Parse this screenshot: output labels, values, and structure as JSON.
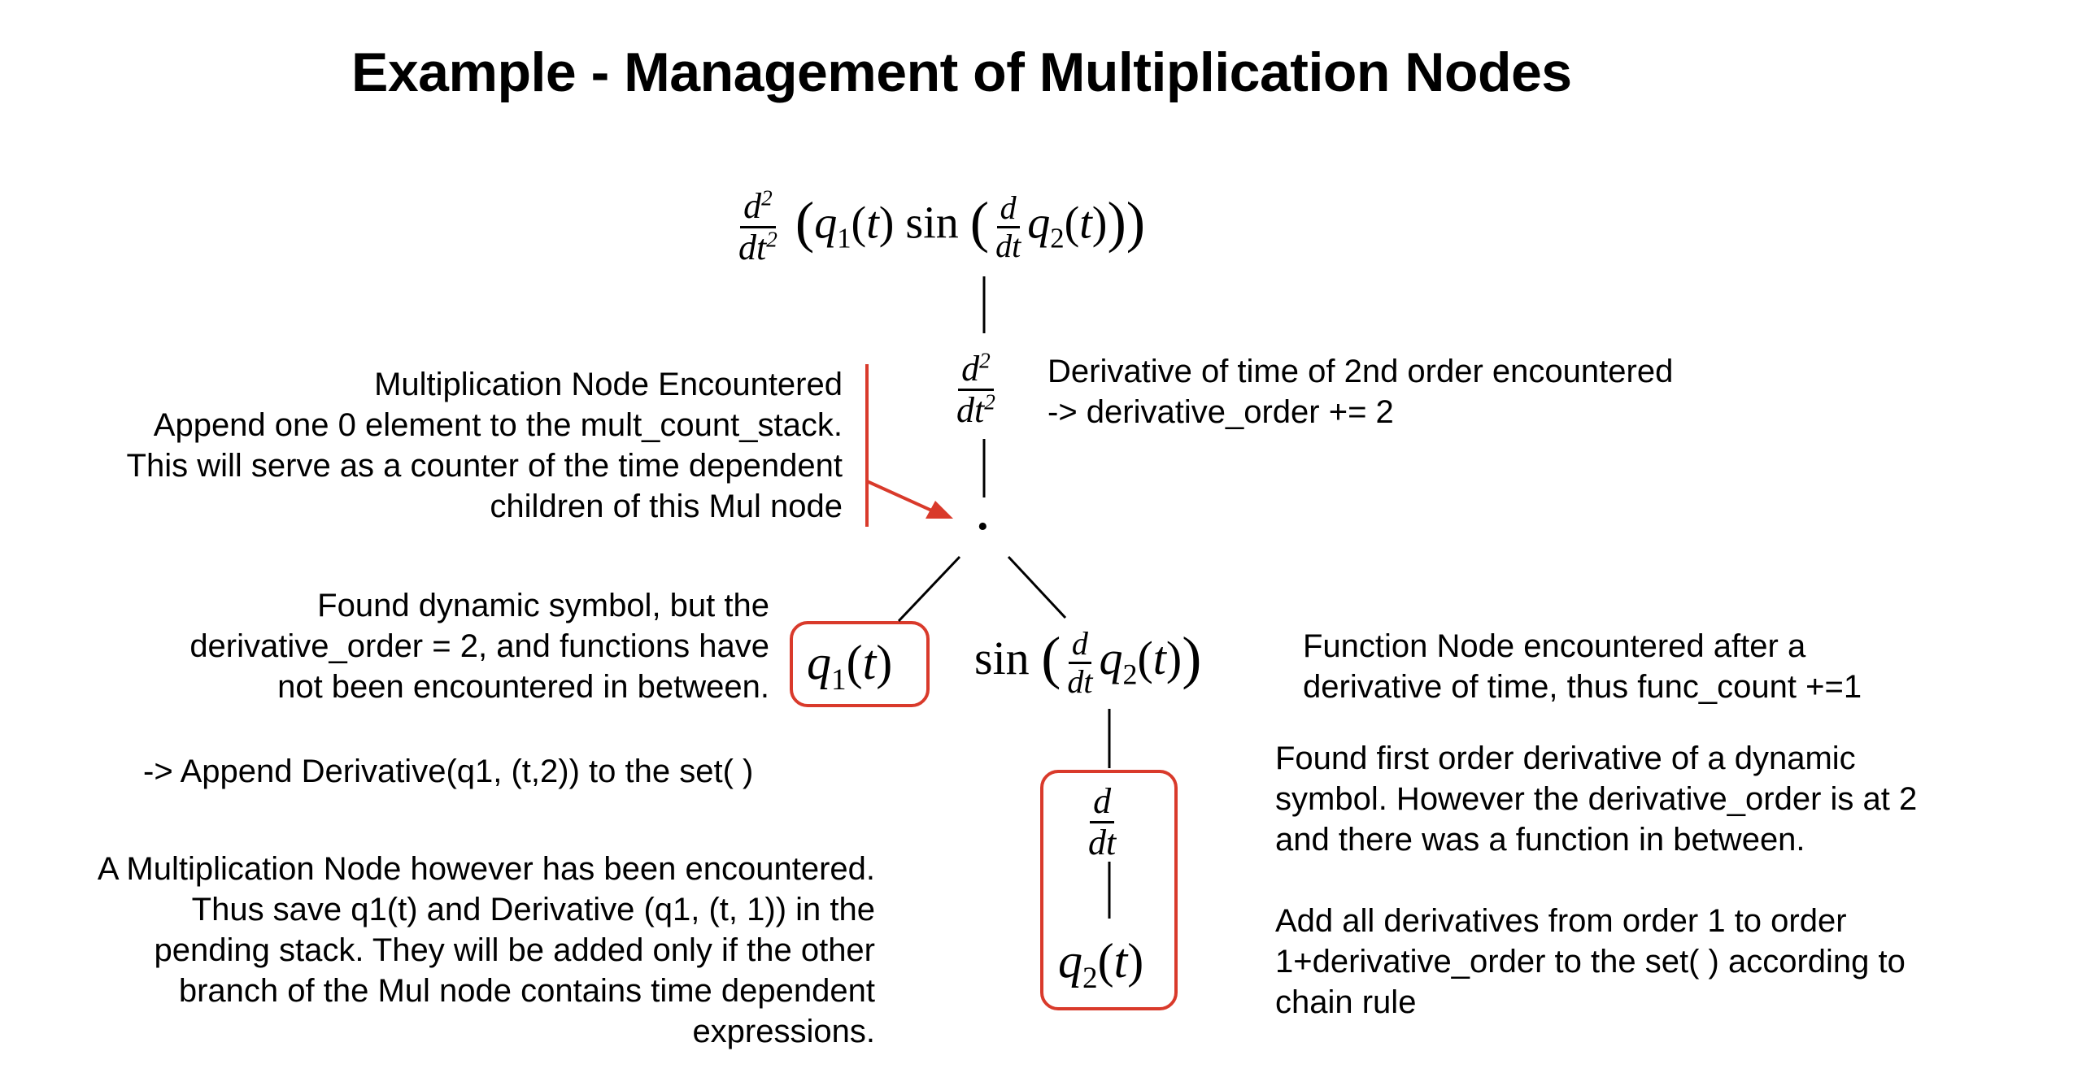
{
  "title": "Example - Management of Multiplication Nodes",
  "math": {
    "d": "d",
    "dt": "dt",
    "d2": "d",
    "dt2": "dt",
    "sup2": "2",
    "q": "q",
    "sub1": "1",
    "sub2": "2",
    "t": "t",
    "sin": "sin",
    "lparen": "(",
    "rparen": ")",
    "dot": "·"
  },
  "notes": {
    "mul_node": [
      "Multiplication Node Encountered",
      "Append one 0 element to the mult_count_stack.",
      "This will serve as a counter of the time dependent",
      "children of this Mul node"
    ],
    "derivative_2nd": [
      "Derivative of time of 2nd order encountered",
      "-> derivative_order += 2"
    ],
    "dynamic_symbol": [
      "Found dynamic symbol, but the",
      "derivative_order = 2, and  functions have",
      "not been encountered in between."
    ],
    "append_derivative": "-> Append Derivative(q1, (t,2)) to the set( )",
    "mul_pending": [
      "A Multiplication Node however has been encountered.",
      "Thus save q1(t) and Derivative (q1, (t, 1)) in the",
      "pending stack. They will be added only if the other",
      "branch of the Mul node contains time dependent",
      "expressions."
    ],
    "function_node": [
      "Function  Node encountered after a",
      "derivative of time, thus func_count +=1"
    ],
    "first_order": [
      "Found first order derivative of a dynamic",
      "symbol. However the derivative_order is at 2",
      "and there was a function in between."
    ],
    "add_all": [
      "Add all derivatives from order 1 to order",
      "1+derivative_order to the set( ) according to",
      "chain rule"
    ]
  },
  "colors": {
    "accent": "#d93a2b",
    "ink": "#000000",
    "background": "#ffffff"
  }
}
